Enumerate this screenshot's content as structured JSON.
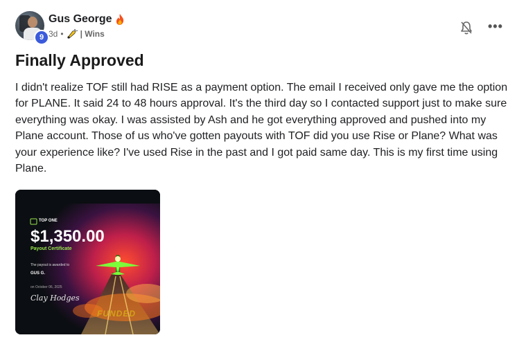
{
  "post": {
    "author": {
      "name": "Gus George",
      "level": "9"
    },
    "meta": {
      "time": "3d",
      "separator": "•",
      "category": "| Wins"
    },
    "title": "Finally Approved",
    "body": "I didn't realize TOF still had RISE as a payment option. The email I received only gave me the option for PLANE. It said 24 to 48 hours approval. It's the third day so I contacted support just to make sure everything was okay. I was assisted by Ash and he got everything approved and pushed into my Plane account. Those of us who've gotten payouts with TOF did you use Rise or Plane? What was your experience like? I've used Rise in the past and I got paid same day. This is my first time using Plane.",
    "actions": {
      "more_label": "•••"
    },
    "icons": {
      "flame": "fire-icon",
      "category": "trumpet-icon",
      "bell": "bell-icon",
      "more": "more-icon"
    }
  },
  "certificate": {
    "brand": "TOP ONE",
    "amount": "$1,350.00",
    "subtitle": "Payout Certificate",
    "awarded_text": "The payout is awarded to",
    "recipient": "GUS G.",
    "date": "on October 06, 2025",
    "signature": "Clay Hodges",
    "funded": "FUNDED"
  },
  "colors": {
    "level_badge": "#3b5bdb",
    "accent_green": "#9ae84d",
    "funded_gold": "#d4a017"
  }
}
